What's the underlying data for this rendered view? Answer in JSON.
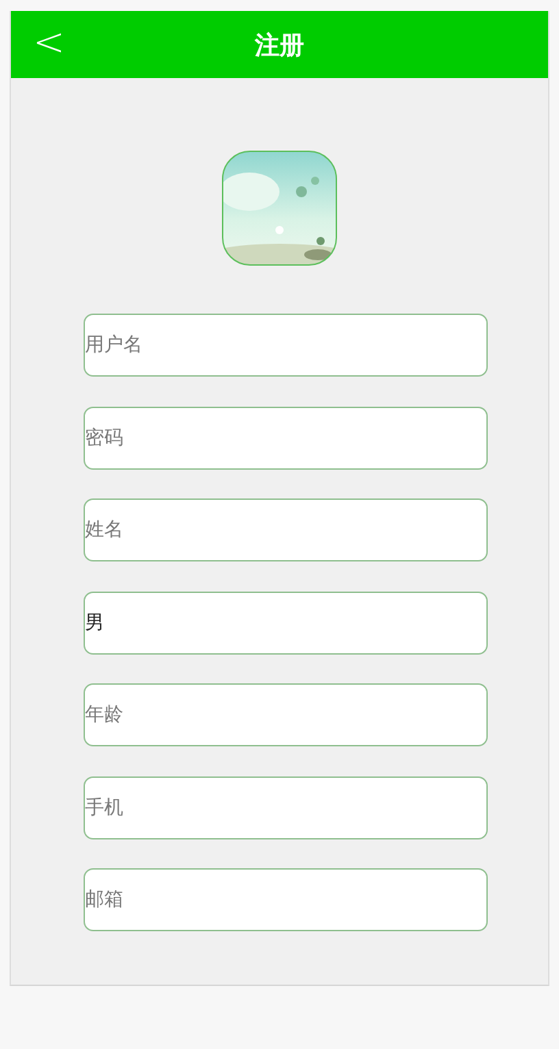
{
  "header": {
    "back_icon": "<",
    "title": "注册"
  },
  "fields": [
    {
      "placeholder": "用户名"
    },
    {
      "placeholder": "密码"
    },
    {
      "placeholder": "姓名"
    },
    {
      "value": "男"
    },
    {
      "placeholder": "年龄"
    },
    {
      "placeholder": "手机"
    },
    {
      "placeholder": "邮箱"
    }
  ]
}
